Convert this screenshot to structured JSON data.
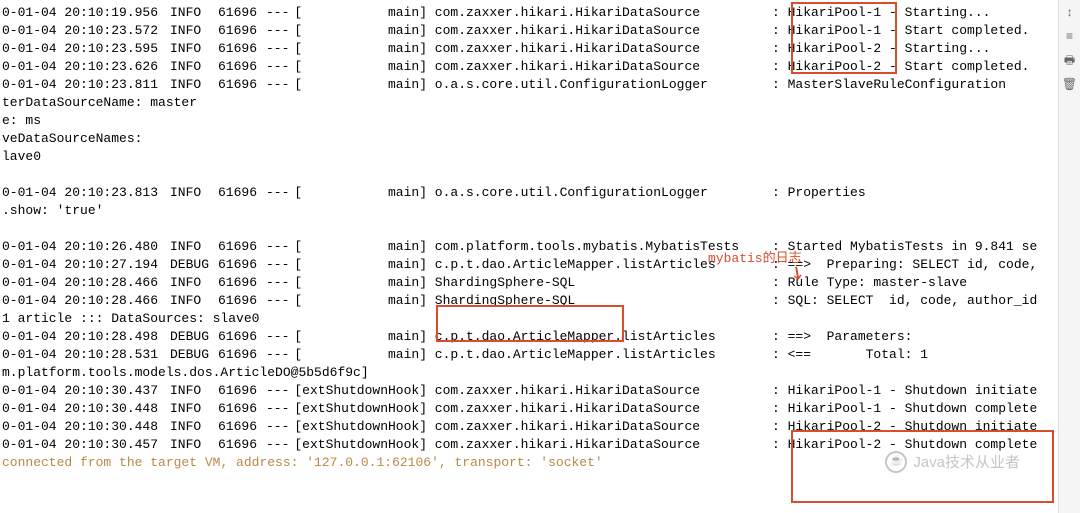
{
  "annotation_label": "mybatis的日志",
  "watermark_text": "Java技术从业者",
  "sidebar": {
    "wrap_icon": "↕",
    "menu_icon": "≡",
    "print_icon": "🖶",
    "trash_icon": "🗑"
  },
  "rows": [
    {
      "ts": "0-01-04 20:10:19.956",
      "level": "INFO",
      "pid": "61696",
      "dash": "---",
      "thread": "[           main]",
      "logger": " com.zaxxer.hikari.HikariDataSource",
      "msg": ": HikariPool-1 - Starting..."
    },
    {
      "ts": "0-01-04 20:10:23.572",
      "level": "INFO",
      "pid": "61696",
      "dash": "---",
      "thread": "[           main]",
      "logger": " com.zaxxer.hikari.HikariDataSource",
      "msg": ": HikariPool-1 - Start completed."
    },
    {
      "ts": "0-01-04 20:10:23.595",
      "level": "INFO",
      "pid": "61696",
      "dash": "---",
      "thread": "[           main]",
      "logger": " com.zaxxer.hikari.HikariDataSource",
      "msg": ": HikariPool-2 - Starting..."
    },
    {
      "ts": "0-01-04 20:10:23.626",
      "level": "INFO",
      "pid": "61696",
      "dash": "---",
      "thread": "[           main]",
      "logger": " com.zaxxer.hikari.HikariDataSource",
      "msg": ": HikariPool-2 - Start completed."
    },
    {
      "ts": "0-01-04 20:10:23.811",
      "level": "INFO",
      "pid": "61696",
      "dash": "---",
      "thread": "[           main]",
      "logger": " o.a.s.core.util.ConfigurationLogger",
      "msg": ": MasterSlaveRuleConfiguration"
    }
  ],
  "wrap1": [
    "terDataSourceName: master",
    "e: ms",
    "veDataSourceNames:",
    "lave0",
    ""
  ],
  "row_props": {
    "ts": "0-01-04 20:10:23.813",
    "level": "INFO",
    "pid": "61696",
    "dash": "---",
    "thread": "[           main]",
    "logger": " o.a.s.core.util.ConfigurationLogger",
    "msg": ": Properties"
  },
  "wrap2": [
    ".show: 'true'",
    ""
  ],
  "rows2": [
    {
      "ts": "0-01-04 20:10:26.480",
      "level": "INFO",
      "pid": "61696",
      "dash": "---",
      "thread": "[           main]",
      "logger": " com.platform.tools.mybatis.MybatisTests",
      "msg": ": Started MybatisTests in 9.841 se"
    },
    {
      "ts": "0-01-04 20:10:27.194",
      "level": "DEBUG",
      "pid": "61696",
      "dash": "---",
      "thread": "[           main]",
      "logger": " c.p.t.dao.ArticleMapper.listArticles",
      "msg": ": ==>  Preparing: SELECT id, code,"
    },
    {
      "ts": "0-01-04 20:10:28.466",
      "level": "INFO",
      "pid": "61696",
      "dash": "---",
      "thread": "[           main]",
      "logger": " ShardingSphere-SQL",
      "msg": ": Rule Type: master-slave"
    },
    {
      "ts": "0-01-04 20:10:28.466",
      "level": "INFO",
      "pid": "61696",
      "dash": "---",
      "thread": "[           main]",
      "logger": " ShardingSphere-SQL",
      "msg": ": SQL: SELECT  id, code, author_id"
    }
  ],
  "wrap3": [
    "1 article ::: DataSources: slave0"
  ],
  "rows3": [
    {
      "ts": "0-01-04 20:10:28.498",
      "level": "DEBUG",
      "pid": "61696",
      "dash": "---",
      "thread": "[           main]",
      "logger": " c.p.t.dao.ArticleMapper.listArticles",
      "msg": ": ==>  Parameters:"
    },
    {
      "ts": "0-01-04 20:10:28.531",
      "level": "DEBUG",
      "pid": "61696",
      "dash": "---",
      "thread": "[           main]",
      "logger": " c.p.t.dao.ArticleMapper.listArticles",
      "msg": ": <==       Total: 1"
    }
  ],
  "wrap4": [
    "m.platform.tools.models.dos.ArticleDO@5b5d6f9c]"
  ],
  "rows4": [
    {
      "ts": "0-01-04 20:10:30.437",
      "level": "INFO",
      "pid": "61696",
      "dash": "---",
      "thread": "[extShutdownHook]",
      "logger": " com.zaxxer.hikari.HikariDataSource",
      "msg": ": HikariPool-1 - Shutdown initiate"
    },
    {
      "ts": "0-01-04 20:10:30.448",
      "level": "INFO",
      "pid": "61696",
      "dash": "---",
      "thread": "[extShutdownHook]",
      "logger": " com.zaxxer.hikari.HikariDataSource",
      "msg": ": HikariPool-1 - Shutdown complete"
    },
    {
      "ts": "0-01-04 20:10:30.448",
      "level": "INFO",
      "pid": "61696",
      "dash": "---",
      "thread": "[extShutdownHook]",
      "logger": " com.zaxxer.hikari.HikariDataSource",
      "msg": ": HikariPool-2 - Shutdown initiate"
    },
    {
      "ts": "0-01-04 20:10:30.457",
      "level": "INFO",
      "pid": "61696",
      "dash": "---",
      "thread": "[extShutdownHook]",
      "logger": " com.zaxxer.hikari.HikariDataSource",
      "msg": ": HikariPool-2 - Shutdown complete"
    }
  ],
  "bottom_line": "connected from the target VM, address: '127.0.0.1:62106', transport: 'socket'"
}
